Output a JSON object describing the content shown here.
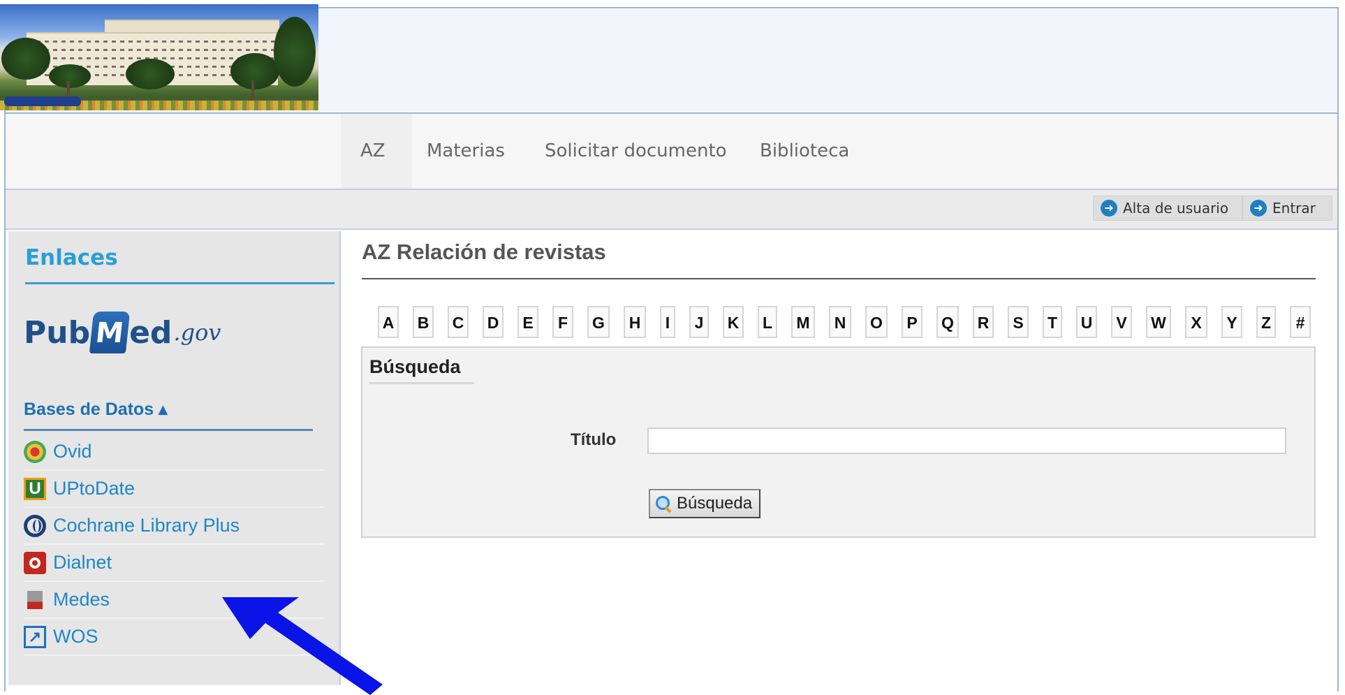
{
  "header": {
    "banner_alt": "Hospital building banner"
  },
  "nav": {
    "items": [
      {
        "label": "AZ",
        "active": true
      },
      {
        "label": "Materias"
      },
      {
        "label": "Solicitar documento"
      },
      {
        "label": "Biblioteca"
      }
    ]
  },
  "userbar": {
    "register_label": "Alta de usuario",
    "login_label": "Entrar"
  },
  "sidebar": {
    "title": "Enlaces",
    "pubmed": {
      "pub": "Pub",
      "m": "M",
      "ed": "ed",
      "gov": ".gov"
    },
    "databases_header": "Bases de Datos ▴",
    "databases": [
      {
        "label": "Ovid",
        "icon": "ovid-icon"
      },
      {
        "label": "UPtoDate",
        "icon": "uptodate-icon"
      },
      {
        "label": "Cochrane Library Plus",
        "icon": "cochrane-icon"
      },
      {
        "label": "Dialnet",
        "icon": "dialnet-icon"
      },
      {
        "label": "Medes",
        "icon": "medes-icon"
      },
      {
        "label": "WOS",
        "icon": "external-link-icon"
      }
    ]
  },
  "main": {
    "title": "AZ Relación de revistas",
    "letters": [
      "A",
      "B",
      "C",
      "D",
      "E",
      "F",
      "G",
      "H",
      "I",
      "J",
      "K",
      "L",
      "M",
      "N",
      "O",
      "P",
      "Q",
      "R",
      "S",
      "T",
      "U",
      "V",
      "W",
      "X",
      "Y",
      "Z",
      "#"
    ],
    "search": {
      "legend": "Búsqueda",
      "field_label": "Título",
      "field_value": "",
      "button_label": "Búsqueda"
    }
  },
  "colors": {
    "link": "#1f86c6",
    "accent": "#2a9fd6",
    "annotation_arrow": "#0a14e6"
  }
}
